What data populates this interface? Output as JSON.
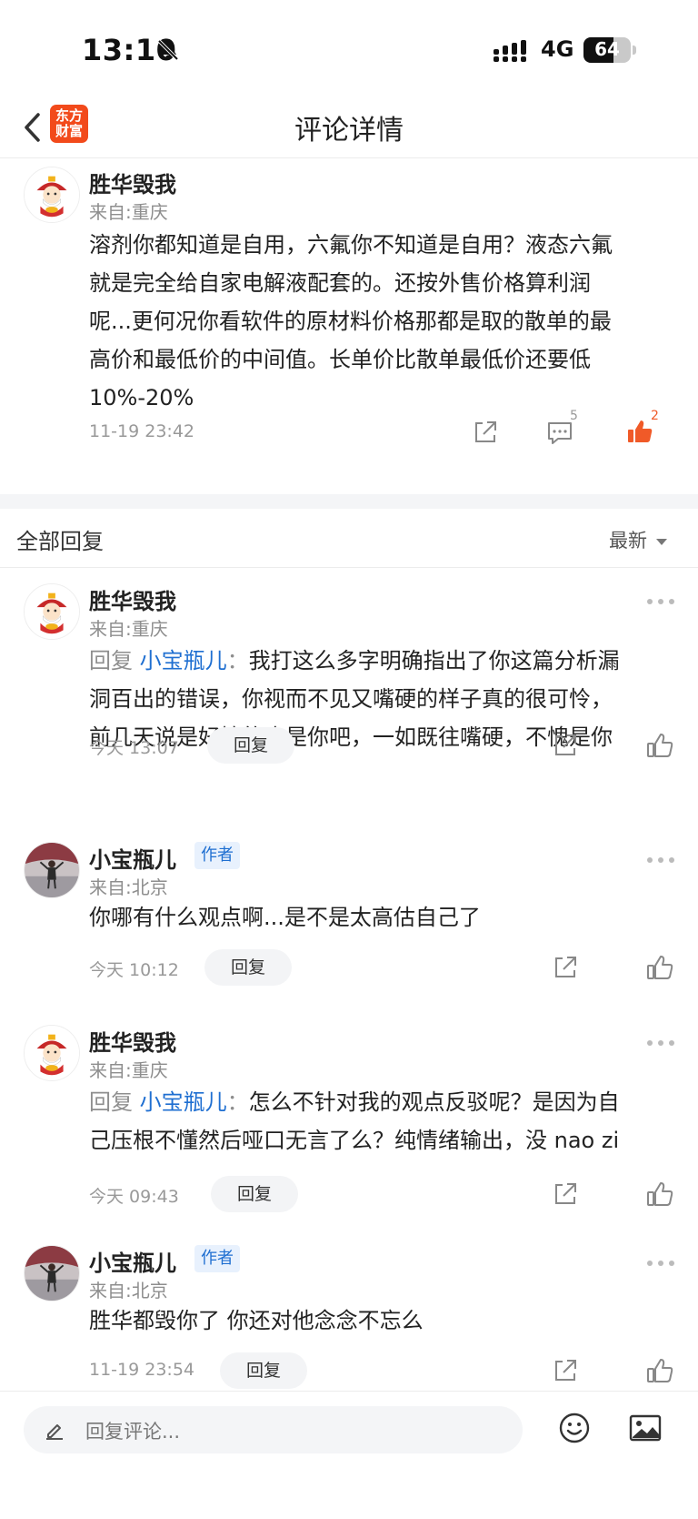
{
  "status_bar": {
    "time": "13:10",
    "network": "4G",
    "battery": "64"
  },
  "nav": {
    "title": "评论详情",
    "logo_line1": "东方",
    "logo_line2": "财富"
  },
  "main_comment": {
    "username": "胜华毁我",
    "location": "来自:重庆",
    "lines": [
      "溶剂你都知道是自用，六氟你不知道是自用？液态六氟",
      "就是完全给自家电解液配套的。还按外售价格算利润",
      "呢...更何况你看软件的原材料价格那都是取的散单的最",
      "高价和最低价的中间值。长单价比散单最低价还要低",
      "10%-20%"
    ],
    "time": "11-19 23:42",
    "comment_count": "5",
    "like_count": "2"
  },
  "replies_header": {
    "label": "全部回复",
    "sort": "最新"
  },
  "replies": [
    {
      "username": "胜华毁我",
      "location": "来自:重庆",
      "reply_prefix": "回复",
      "mention": "小宝瓶儿",
      "colon": "：",
      "line1": "我打这么多字明确指出了你这篇分析漏",
      "line2": "洞百出的错误，你视而不见又嘴硬的样子真的很可怜，",
      "line3": "前几天说是好榜的也是你吧，一如既往嘴硬，不愧是你",
      "time": "今天 13:07",
      "reply_label": "回复"
    },
    {
      "username": "小宝瓶儿",
      "author_tag": "作者",
      "location": "来自:北京",
      "line1": "你哪有什么观点啊...是不是太高估自己了",
      "time": "今天 10:12",
      "reply_label": "回复"
    },
    {
      "username": "胜华毁我",
      "location": "来自:重庆",
      "reply_prefix": "回复",
      "mention": "小宝瓶儿",
      "colon": "：",
      "line1": "怎么不针对我的观点反驳呢？是因为自",
      "line2": "己压根不懂然后哑口无言了么？纯情绪输出，没 nao zi",
      "time": "今天 09:43",
      "reply_label": "回复"
    },
    {
      "username": "小宝瓶儿",
      "author_tag": "作者",
      "location": "来自:北京",
      "line1": "胜华都毁你了 你还对他念念不忘么",
      "time": "11-19 23:54",
      "reply_label": "回复"
    }
  ],
  "bottom_bar": {
    "placeholder": "回复评论..."
  },
  "colors": {
    "accent_red": "#f05a28",
    "mention_blue": "#1f6fd1",
    "logo_bg": "#f24a1b"
  }
}
